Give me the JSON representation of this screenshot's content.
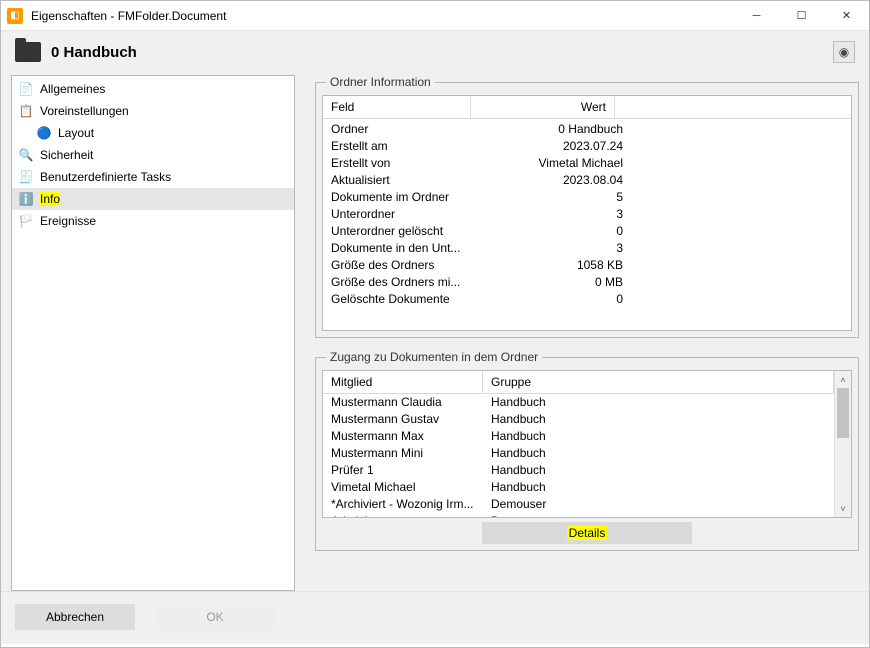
{
  "window": {
    "title": "Eigenschaften - FMFolder.Document"
  },
  "header": {
    "title": "0 Handbuch"
  },
  "sidebar": {
    "items": [
      {
        "label": "Allgemeines",
        "icon": "📄",
        "iconName": "document-icon"
      },
      {
        "label": "Voreinstellungen",
        "icon": "📋",
        "iconName": "list-icon"
      },
      {
        "label": "Layout",
        "icon": "🔵",
        "iconName": "dot-icon",
        "indent": true
      },
      {
        "label": "Sicherheit",
        "icon": "🔍",
        "iconName": "lock-icon"
      },
      {
        "label": "Benutzerdefinierte Tasks",
        "icon": "🧾",
        "iconName": "tasks-icon"
      },
      {
        "label": "Info",
        "icon": "ℹ️",
        "iconName": "info-icon",
        "selected": true,
        "highlight": true
      },
      {
        "label": "Ereignisse",
        "icon": "🏳️",
        "iconName": "flag-icon"
      }
    ]
  },
  "folder_info": {
    "legend": "Ordner Information",
    "headers": {
      "feld": "Feld",
      "wert": "Wert"
    },
    "rows": [
      {
        "feld": "Ordner",
        "wert": "0 Handbuch"
      },
      {
        "feld": "Erstellt am",
        "wert": "2023.07.24"
      },
      {
        "feld": "Erstellt von",
        "wert": "Vimetal Michael"
      },
      {
        "feld": "Aktualisiert",
        "wert": "2023.08.04"
      },
      {
        "feld": "Dokumente im Ordner",
        "wert": "5"
      },
      {
        "feld": "Unterordner",
        "wert": "3"
      },
      {
        "feld": "Unterordner gelöscht",
        "wert": "0"
      },
      {
        "feld": "Dokumente in den Unt...",
        "wert": "3"
      },
      {
        "feld": "Größe des Ordners",
        "wert": "1058 KB"
      },
      {
        "feld": "Größe des Ordners mi...",
        "wert": "0 MB"
      },
      {
        "feld": "Gelöschte Dokumente",
        "wert": "0"
      }
    ]
  },
  "access": {
    "legend": "Zugang zu Dokumenten in dem Ordner",
    "headers": {
      "mitglied": "Mitglied",
      "gruppe": "Gruppe"
    },
    "rows": [
      {
        "mitglied": "Mustermann Claudia",
        "gruppe": "Handbuch"
      },
      {
        "mitglied": "Mustermann Gustav",
        "gruppe": "Handbuch"
      },
      {
        "mitglied": "Mustermann Max",
        "gruppe": "Handbuch"
      },
      {
        "mitglied": "Mustermann Mini",
        "gruppe": "Handbuch"
      },
      {
        "mitglied": "Prüfer 1",
        "gruppe": "Handbuch"
      },
      {
        "mitglied": "Vimetal Michael",
        "gruppe": "Handbuch"
      },
      {
        "mitglied": "*Archiviert - Wozonig Irm...",
        "gruppe": "Demouser"
      },
      {
        "mitglied": "Administrator",
        "gruppe": "Demouser"
      }
    ]
  },
  "buttons": {
    "details": "Details",
    "cancel": "Abbrechen",
    "ok": "OK"
  }
}
